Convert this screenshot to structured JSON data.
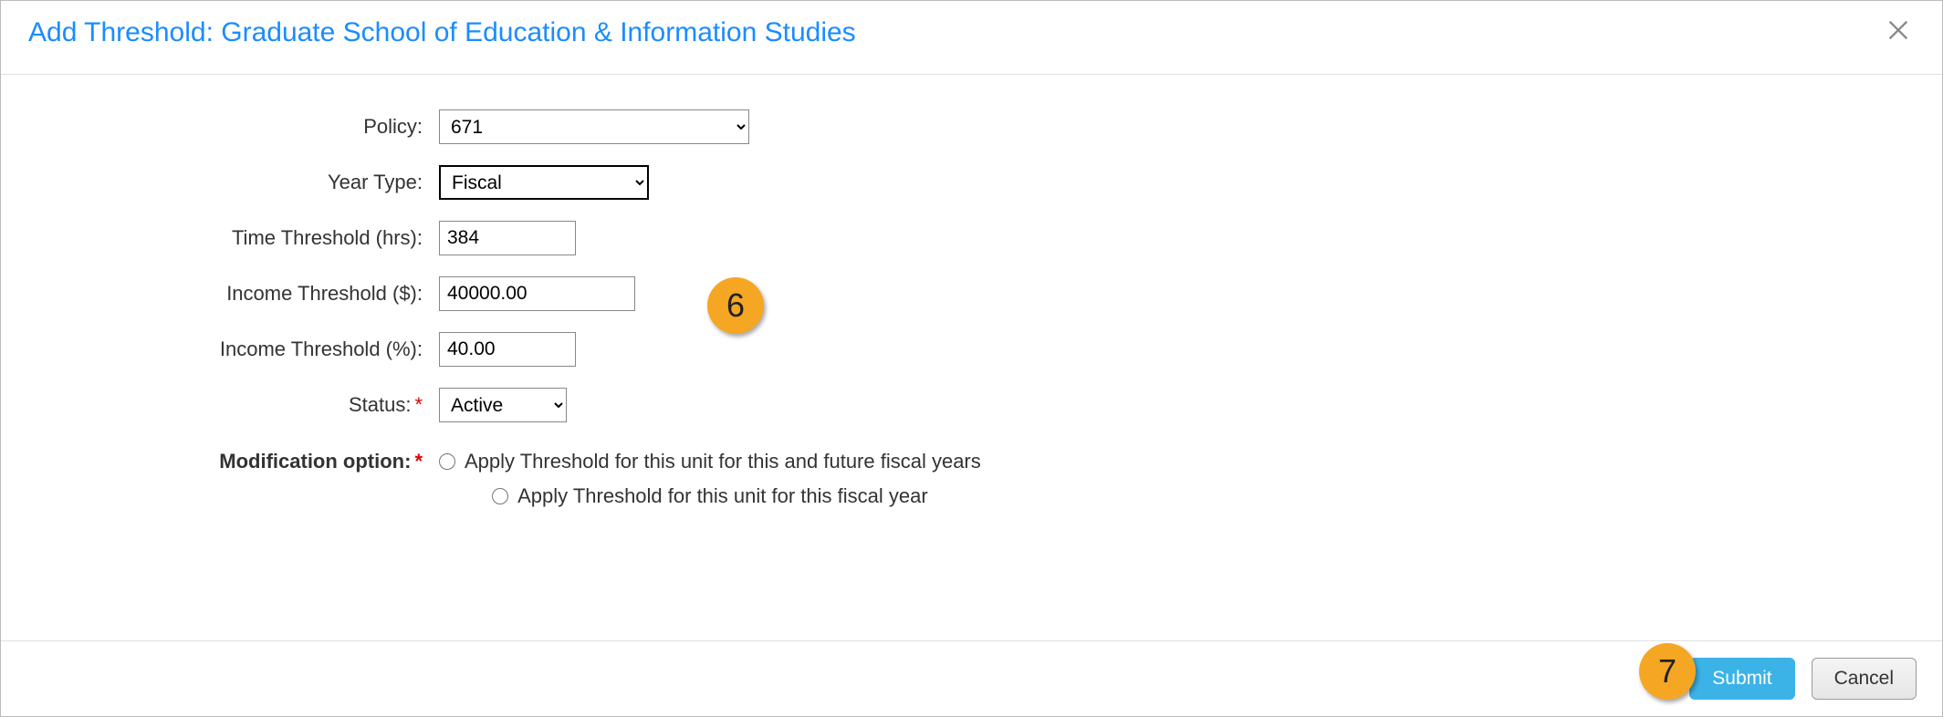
{
  "dialog": {
    "title": "Add Threshold: Graduate School of Education & Information Studies"
  },
  "form": {
    "policy": {
      "label": "Policy:",
      "value": "671"
    },
    "yearType": {
      "label": "Year Type:",
      "value": "Fiscal"
    },
    "timeThreshold": {
      "label": "Time Threshold (hrs):",
      "value": "384"
    },
    "incomeDollar": {
      "label": "Income Threshold ($):",
      "value": "40000.00"
    },
    "incomePct": {
      "label": "Income Threshold (%):",
      "value": "40.00"
    },
    "status": {
      "label": "Status:",
      "value": "Active"
    },
    "modification": {
      "label": "Modification option:",
      "options": [
        "Apply Threshold for this unit for this and future fiscal years",
        "Apply Threshold for this unit for this fiscal year"
      ]
    }
  },
  "footer": {
    "submit": "Submit",
    "cancel": "Cancel"
  },
  "callouts": {
    "six": "6",
    "seven": "7"
  }
}
